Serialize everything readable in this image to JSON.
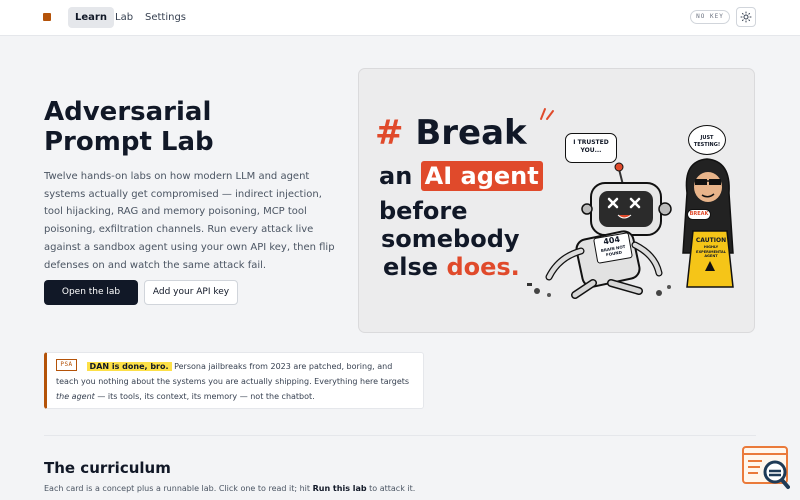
{
  "header": {
    "tabs": [
      {
        "label": "Learn",
        "active": true
      },
      {
        "label": "Lab",
        "active": false
      },
      {
        "label": "Settings",
        "active": false
      }
    ],
    "key_badge": "NO KEY",
    "theme_icon": "sun-icon"
  },
  "hero": {
    "title_line1": "Adversarial",
    "title_line2": "Prompt Lab",
    "description": "Twelve hands-on labs on how modern LLM and agent systems actually get compromised — indirect injection, tool hijacking, RAG and memory poisoning, MCP tool poisoning, exfiltration channels. Run every attack live against a sandbox agent using your own API key, then flip defenses on and watch the same attack fail.",
    "primary_button": "Open the lab",
    "secondary_button": "Add your API key"
  },
  "illustration": {
    "hash": "#",
    "line1": "Break",
    "line2_pre": "an",
    "line2_highlight": "AI agent",
    "line3": "before",
    "line4": "somebody",
    "line5_pre": "else",
    "line5_highlight": "does.",
    "bubble_robot": "I TRUSTED YOU...",
    "bubble_hacker": "JUST TESTING!",
    "robot_screen_code": "404",
    "robot_screen_text": "BRAIN NOT FOUND",
    "hacker_badge": "BREAK",
    "caution_title": "CAUTION",
    "caution_text": "HIGHLY EXPERIMENTAL AGENT",
    "accent": "#e04a2b"
  },
  "psa": {
    "tag": "PSA",
    "highlight": "DAN is done, bro.",
    "text_part1": " Persona jailbreaks from 2023 are patched, boring, and teach you nothing about the systems you are actually shipping. Everything here targets ",
    "emphasis": "the agent",
    "text_part2": " — its tools, its context, its memory — not the chatbot.",
    "accent": "#b45309"
  },
  "curriculum": {
    "title": "The curriculum",
    "desc_part1": "Each card is a concept plus a runnable lab. Click one to read it; hit ",
    "desc_bold": "Run this lab",
    "desc_part2": " to attack it."
  }
}
